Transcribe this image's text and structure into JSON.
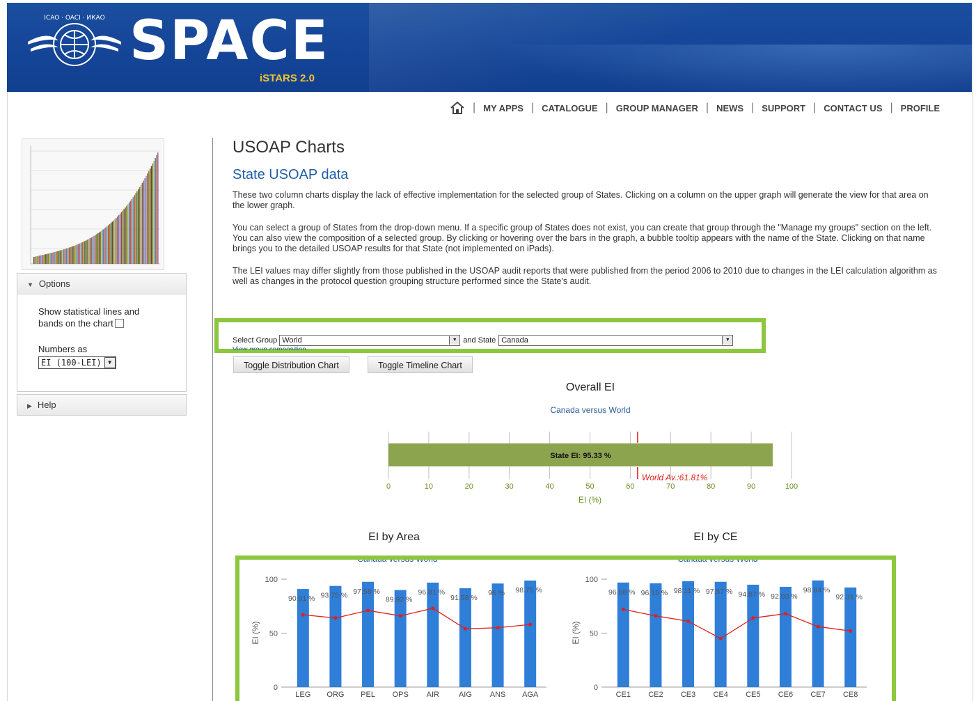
{
  "header": {
    "logo_text": "SPACE",
    "logo_sub": "iSTARS 2.0",
    "emblem_text": "ICAO · OACI · ИКАО"
  },
  "nav": {
    "items": [
      "MY APPS",
      "CATALOGUE",
      "GROUP MANAGER",
      "NEWS",
      "SUPPORT",
      "CONTACT US",
      "PROFILE"
    ],
    "home_icon": "home-icon"
  },
  "sidebar": {
    "options_label": "Options",
    "show_lines_label": "Show statistical lines and bands on the chart",
    "numbers_as_label": "Numbers as",
    "numbers_as_value": "EI (100-LEI)",
    "help_label": "Help"
  },
  "main": {
    "title": "USOAP Charts",
    "subtitle": "State USOAP data",
    "paragraphs": [
      "These two column charts display the lack of effective implementation for the selected group of States. Clicking on a column on the upper graph will generate the view for that area on the lower graph.",
      "You can select a group of States from the drop-down menu. If a specific group of States does not exist, you can create that group through the \"Manage my groups\" section on the left. You can also view the composition of a selected group. By clicking or hovering over the bars in the graph, a bubble tooltip appears with the name of the State. Clicking on that name brings you to the detailed USOAP results for that State (not implemented on iPads).",
      "The LEI values may differ slightly from those published in the USOAP audit reports that were published from the period 2006 to 2010 due to changes in the LEI calculation algorithm as well as changes in the protocol question grouping structure performed since the State's audit."
    ],
    "select_group_label": "Select Group",
    "select_group_value": "World",
    "and_state_label": "and State",
    "state_value": "Canada",
    "view_composition": "View group composition",
    "toggle_distribution": "Toggle Distribution Chart",
    "toggle_timeline": "Toggle Timeline Chart"
  },
  "chart_data": [
    {
      "type": "bar",
      "title": "Overall EI",
      "subtitle": "Canada versus World",
      "xlabel": "EI (%)",
      "xlim": [
        0,
        100
      ],
      "ticks": [
        0,
        10,
        20,
        30,
        40,
        50,
        60,
        70,
        80,
        90,
        100
      ],
      "values": [
        95.33
      ],
      "bar_label": "State EI: 95.33 %",
      "reference": {
        "label": "World Av.:61.81%",
        "value": 61.81
      },
      "colors": {
        "bar": "#8ca44e",
        "reference": "#e0201c"
      }
    },
    {
      "type": "bar",
      "title": "EI by Area",
      "subtitle": "Canada versus World",
      "ylabel": "EI (%)",
      "ylim": [
        0,
        100
      ],
      "yticks": [
        0,
        50,
        100
      ],
      "categories": [
        "LEG",
        "ORG",
        "PEL",
        "OPS",
        "AIR",
        "AIG",
        "ANS",
        "AGA"
      ],
      "series": [
        {
          "name": "Canada",
          "values": [
            90.91,
            93.75,
            97.58,
            89.92,
            96.81,
            91.58,
            96.0,
            98.75
          ],
          "labels": [
            "90.91 %",
            "93.75 %",
            "97.58 %",
            "89.92 %",
            "96.81 %",
            "91.58 %",
            "96 %",
            "98.75 %"
          ]
        },
        {
          "name": "World",
          "values": [
            67,
            64,
            71,
            66,
            73,
            54,
            55,
            58
          ]
        }
      ],
      "colors": {
        "bar": "#2f7ed8",
        "line": "#e0201c"
      }
    },
    {
      "type": "bar",
      "title": "EI by CE",
      "subtitle": "Canada versus World",
      "ylabel": "EI (%)",
      "ylim": [
        0,
        100
      ],
      "yticks": [
        0,
        50,
        100
      ],
      "categories": [
        "CE1",
        "CE2",
        "CE3",
        "CE4",
        "CE5",
        "CE6",
        "CE7",
        "CE8"
      ],
      "series": [
        {
          "name": "Canada",
          "values": [
            96.88,
            96.15,
            98.11,
            97.57,
            94.87,
            92.93,
            98.84,
            92.31
          ],
          "labels": [
            "96.88 %",
            "96.15 %",
            "98.11 %",
            "97.57 %",
            "94.87 %",
            "92.93 %",
            "98.84 %",
            "92.31 %"
          ]
        },
        {
          "name": "World",
          "values": [
            72,
            66,
            61,
            45,
            64,
            68,
            56,
            52
          ]
        }
      ],
      "colors": {
        "bar": "#2f7ed8",
        "line": "#e0201c"
      }
    }
  ]
}
